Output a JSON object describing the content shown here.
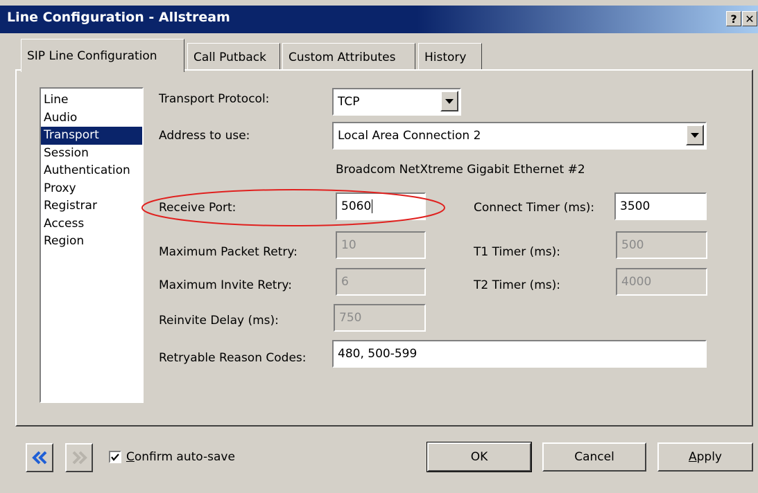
{
  "window": {
    "title": "Line Configuration - Allstream",
    "help_label": "?",
    "close_label": "✕"
  },
  "tabs": [
    {
      "label": "SIP Line Configuration"
    },
    {
      "label": "Call Putback"
    },
    {
      "label": "Custom Attributes"
    },
    {
      "label": "History"
    }
  ],
  "nav": {
    "items": [
      "Line",
      "Audio",
      "Transport",
      "Session",
      "Authentication",
      "Proxy",
      "Registrar",
      "Access",
      "Region"
    ],
    "selected": "Transport"
  },
  "form": {
    "transport_protocol_label": "Transport Protocol:",
    "transport_protocol_value": "TCP",
    "address_label": "Address to use:",
    "address_value": "Local Area Connection 2",
    "adapter_name": "Broadcom NetXtreme Gigabit Ethernet #2",
    "receive_port_label": "Receive Port:",
    "receive_port_value": "5060",
    "connect_timer_label": "Connect Timer (ms):",
    "connect_timer_value": "3500",
    "max_packet_retry_label": "Maximum Packet Retry:",
    "max_packet_retry_value": "10",
    "t1_timer_label": "T1 Timer (ms):",
    "t1_timer_value": "500",
    "max_invite_retry_label": "Maximum Invite Retry:",
    "max_invite_retry_value": "6",
    "t2_timer_label": "T2 Timer (ms):",
    "t2_timer_value": "4000",
    "reinvite_delay_label": "Reinvite Delay (ms):",
    "reinvite_delay_value": "750",
    "retryable_codes_label": "Retryable Reason Codes:",
    "retryable_codes_value": "480, 500-599"
  },
  "footer": {
    "confirm_autosave_first": "C",
    "confirm_autosave_rest": "onfirm auto-save",
    "confirm_autosave_checked": true,
    "ok_label": "OK",
    "cancel_label": "Cancel",
    "apply_first": "A",
    "apply_rest": "pply"
  },
  "colors": {
    "title_bar": "#0a246a",
    "selection": "#0a246a",
    "annotation_ellipse": "#e0201e",
    "nav_arrow_active": "#1f5fd6"
  },
  "icons": {
    "back": "double-chevron-left-icon",
    "forward": "double-chevron-right-icon"
  }
}
